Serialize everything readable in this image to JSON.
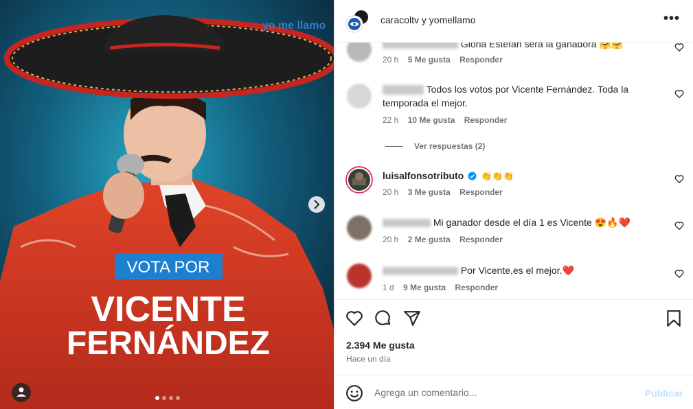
{
  "post": {
    "logo_text": "yo me llamo",
    "banner": "VOTA POR",
    "name_line1": "VICENTE",
    "name_line2": "FERNÁNDEZ",
    "carousel_dots": 4,
    "active_dot": 0
  },
  "header": {
    "title": "caracoltv y yomellamo",
    "more": "•••"
  },
  "comments": [
    {
      "text": "Gloria Estefan será la ganadora 🤗🤗",
      "time": "20 h",
      "likes": "5 Me gusta",
      "reply": "Responder"
    },
    {
      "text": "Todos los votos por Vicente Fernández. Toda la temporada el mejor.",
      "time": "22 h",
      "likes": "10 Me gusta",
      "reply": "Responder",
      "view_replies": "Ver respuestas (2)"
    },
    {
      "username": "luisalfonsotributo",
      "text": "👏👏👏",
      "time": "20 h",
      "likes": "3 Me gusta",
      "reply": "Responder"
    },
    {
      "text": "Mi ganador desde el día 1 es Vicente 😍🔥❤️",
      "time": "20 h",
      "likes": "2 Me gusta",
      "reply": "Responder"
    },
    {
      "text": "Por Vicente,es el mejor.❤️",
      "time": "1 d",
      "likes": "9 Me gusta",
      "reply": "Responder"
    }
  ],
  "actions": {
    "likes": "2.394 Me gusta",
    "time": "Hace un día"
  },
  "add_comment": {
    "placeholder": "Agrega un comentario...",
    "publish": "Publicar"
  },
  "colors": {
    "text": "#262626",
    "secondary": "#737373",
    "verified": "#0095f6",
    "publish_disabled": "#c0dffd",
    "jacket": "#d93a22",
    "banner": "#1c7fd0"
  },
  "icons": [
    "more-options-icon",
    "heart-icon",
    "comment-icon",
    "share-icon",
    "bookmark-icon",
    "emoji-icon",
    "verified-icon",
    "chevron-right-icon",
    "user-tag-icon"
  ]
}
